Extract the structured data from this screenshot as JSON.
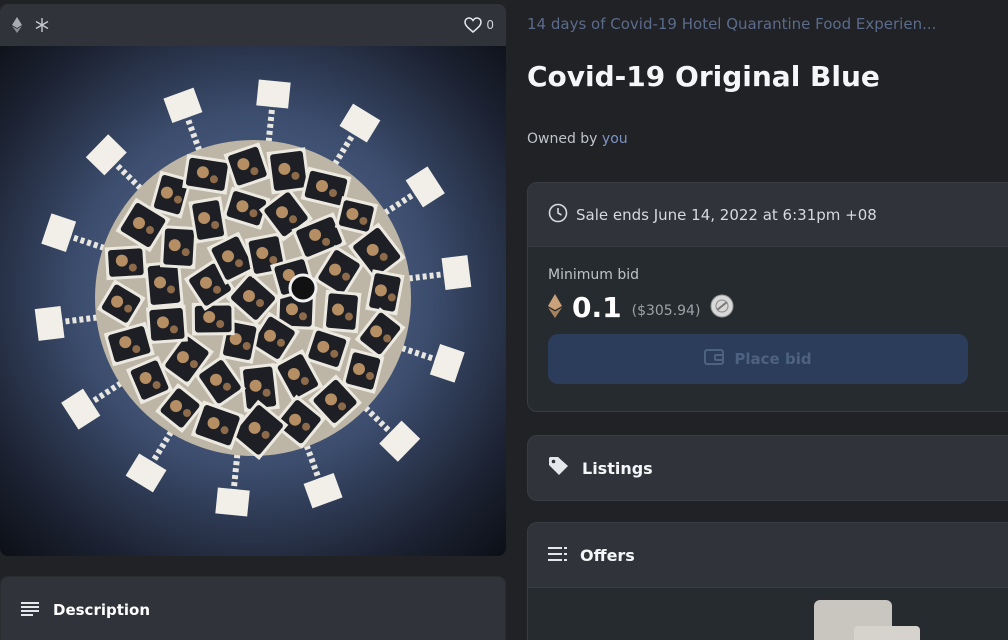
{
  "item": {
    "collection_name": "14 days of Covid-19 Hotel Quarantine Food Experien...",
    "title": "Covid-19 Original Blue",
    "owned_prefix": "Owned by",
    "owner": "you",
    "favorites_count": "0"
  },
  "sale": {
    "ends_text": "Sale ends June 14, 2022 at 6:31pm +08",
    "min_bid_label": "Minimum bid",
    "price": "0.1",
    "fiat": "($305.94)",
    "place_bid_label": "Place bid"
  },
  "panels": {
    "listings_label": "Listings",
    "offers_label": "Offers",
    "description_label": "Description"
  },
  "colors": {
    "accent_link": "#7d93c6",
    "button_bg": "#2c3d5c"
  },
  "icons": {
    "chain": "ethereum-icon",
    "heart": "heart-icon",
    "clock": "clock-icon",
    "tag": "tag-icon",
    "lines": "list-icon",
    "wallet": "wallet-icon"
  }
}
